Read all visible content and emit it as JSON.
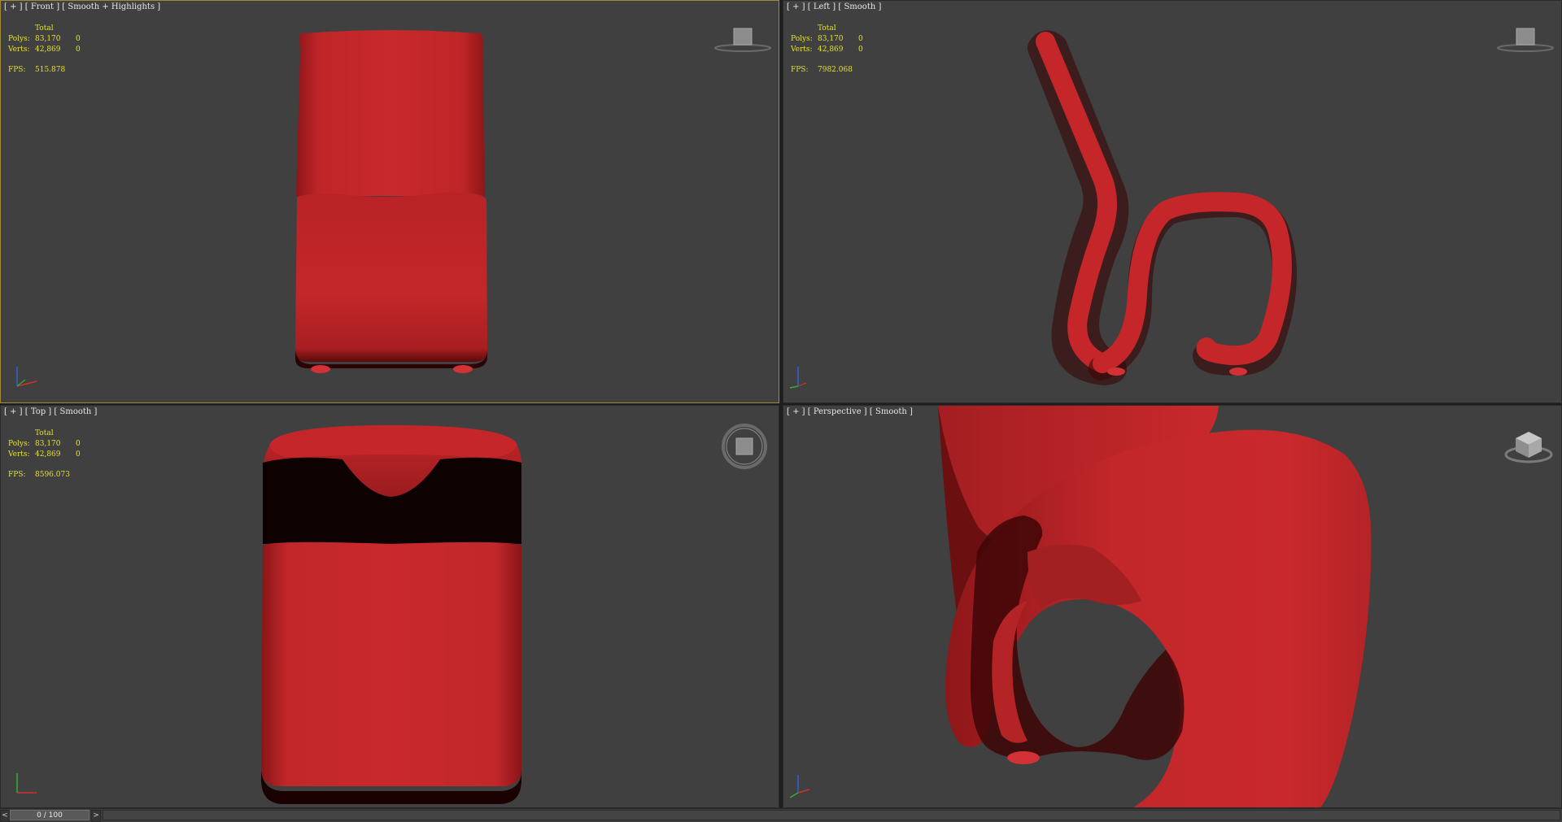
{
  "colors": {
    "viewport_bg": "#404040",
    "active_border": "#a08a3c",
    "stats_text": "#e5e22c",
    "model_red": "#c4262a"
  },
  "viewports": {
    "front": {
      "label_parts": [
        "[ + ]",
        "[ Front ]",
        "[ Smooth + Highlights ]"
      ],
      "total_label": "Total",
      "polys_label": "Polys:",
      "polys_value": "83,170",
      "polys_sel": "0",
      "verts_label": "Verts:",
      "verts_value": "42,869",
      "verts_sel": "0",
      "fps_label": "FPS:",
      "fps_value": "515.878",
      "viewcube_icon": "viewcube-front-icon"
    },
    "left": {
      "label_parts": [
        "[ + ]",
        "[ Left ]",
        "[ Smooth ]"
      ],
      "total_label": "Total",
      "polys_label": "Polys:",
      "polys_value": "83,170",
      "polys_sel": "0",
      "verts_label": "Verts:",
      "verts_value": "42,869",
      "verts_sel": "0",
      "fps_label": "FPS:",
      "fps_value": "7982.068",
      "viewcube_icon": "viewcube-left-icon"
    },
    "top": {
      "label_parts": [
        "[ + ]",
        "[ Top ]",
        "[ Smooth ]"
      ],
      "total_label": "Total",
      "polys_label": "Polys:",
      "polys_value": "83,170",
      "polys_sel": "0",
      "verts_label": "Verts:",
      "verts_value": "42,869",
      "verts_sel": "0",
      "fps_label": "FPS:",
      "fps_value": "8596.073",
      "viewcube_icon": "viewcube-top-icon"
    },
    "perspective": {
      "label_parts": [
        "[ + ]",
        "[ Perspective ]",
        "[ Smooth ]"
      ],
      "viewcube_icon": "viewcube-perspective-icon"
    }
  },
  "timeline": {
    "frame_text": "0 / 100",
    "prev_label": "<",
    "next_label": ">",
    "current_frame": 0,
    "total_frames": 100
  }
}
